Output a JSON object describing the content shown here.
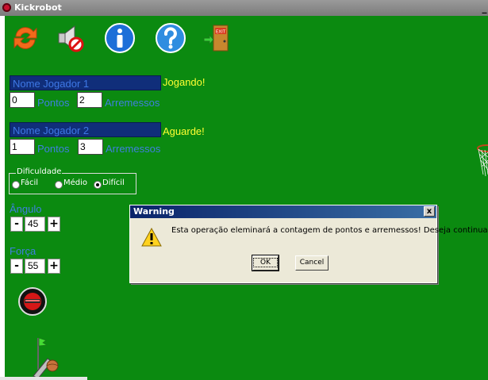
{
  "window": {
    "title": "Kickrobot",
    "minimize_label": "_"
  },
  "toolbar": {
    "icons": [
      "refresh-icon",
      "sound-muted-icon",
      "info-icon",
      "help-icon",
      "exit-door-icon"
    ],
    "exit_sign": "EXIT"
  },
  "player1": {
    "name": "Nome Jogador 1",
    "status": "Jogando!",
    "points": "0",
    "points_label": "Pontos",
    "throws": "2",
    "throws_label": "Arremessos"
  },
  "player2": {
    "name": "Nome Jogador 2",
    "status": "Aguarde!",
    "points": "1",
    "points_label": "Pontos",
    "throws": "3",
    "throws_label": "Arremessos"
  },
  "difficulty": {
    "title": "Dificuldade",
    "options": [
      "Fácil",
      "Médio",
      "Difícil"
    ],
    "selected": "Difícil"
  },
  "angle": {
    "label": "Ângulo",
    "value": "45",
    "minus": "-",
    "plus": "+"
  },
  "force": {
    "label": "Força",
    "value": "55",
    "minus": "-",
    "plus": "+"
  },
  "dialog": {
    "title": "Warning",
    "message": "Esta operação eleminará a contagem de pontos e arremessos! Deseja continuar?",
    "ok_label": "OK",
    "cancel_label": "Cancel",
    "close_label": "x"
  },
  "colors": {
    "background": "#0b8a10",
    "status_text": "#ffff33",
    "label_blue": "#3f7fe0",
    "name_field": "#102e7a"
  }
}
